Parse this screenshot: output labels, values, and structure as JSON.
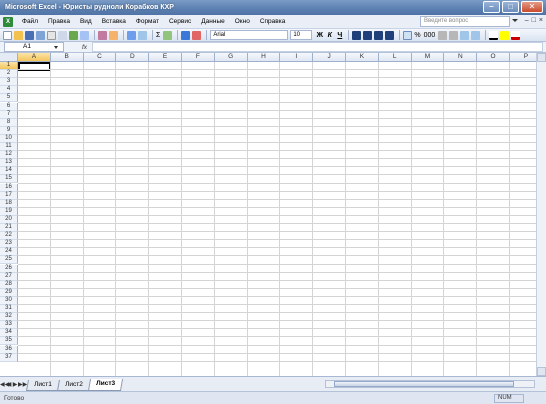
{
  "window": {
    "title": "Microsoft Excel - Юристы рудноли Корабков КХР",
    "min": "–",
    "max": "□",
    "close": "✕"
  },
  "menu": {
    "items": [
      "Файл",
      "Правка",
      "Вид",
      "Вставка",
      "Формат",
      "Сервис",
      "Данные",
      "Окно",
      "Справка"
    ],
    "help_placeholder": "Введите вопрос",
    "doc_btns": [
      "–",
      "□",
      "×"
    ]
  },
  "toolbar": {
    "font_name": "Arial",
    "font_size": "10",
    "bold": "Ж",
    "italic": "К",
    "underline": "Ч",
    "percent": "%",
    "zoom_text": "000"
  },
  "formula": {
    "cell_ref": "A1",
    "fx": "fx",
    "value": ""
  },
  "grid": {
    "columns": [
      "A",
      "B",
      "C",
      "D",
      "E",
      "F",
      "G",
      "H",
      "I",
      "J",
      "K",
      "L",
      "M",
      "N",
      "O",
      "P"
    ],
    "rows": [
      "1",
      "2",
      "3",
      "4",
      "5",
      "6",
      "7",
      "8",
      "9",
      "10",
      "11",
      "12",
      "13",
      "14",
      "15",
      "16",
      "17",
      "18",
      "19",
      "20",
      "21",
      "22",
      "23",
      "24",
      "25",
      "26",
      "27",
      "28",
      "29",
      "30",
      "31",
      "32",
      "33",
      "34",
      "35",
      "36",
      "37"
    ],
    "active_column": "A",
    "active_row": "1"
  },
  "sheets": {
    "tabs": [
      "Лист1",
      "Лист2",
      "Лист3"
    ],
    "active": "Лист3",
    "nav": [
      "◀◀",
      "◀",
      "▶",
      "▶▶"
    ]
  },
  "status": {
    "text": "Готово",
    "mode": "NUM"
  }
}
